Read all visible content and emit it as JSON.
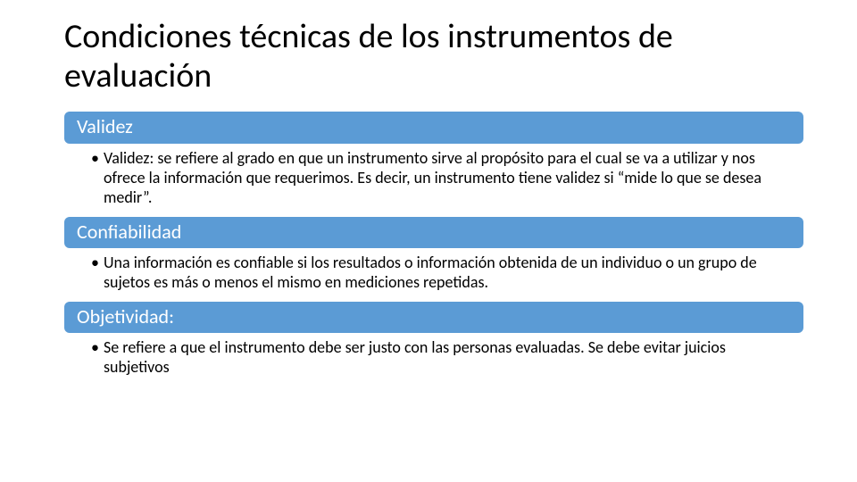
{
  "title": "Condiciones técnicas de los instrumentos de evaluación",
  "sections": [
    {
      "header": "Validez",
      "body": "Validez: se refiere al grado en que un instrumento sirve al propósito para el cual se va a utilizar y nos ofrece la información que requerimos. Es decir, un instrumento tiene validez si “mide lo que se desea medir”."
    },
    {
      "header": "Confiabilidad",
      "body": "Una información es confiable si los resultados o información obtenida de un individuo o un grupo de sujetos es más o menos el mismo en mediciones repetidas."
    },
    {
      "header": "Objetividad:",
      "body": "Se refiere a que el instrumento debe ser justo con las personas evaluadas. Se debe evitar juicios subjetivos"
    }
  ]
}
